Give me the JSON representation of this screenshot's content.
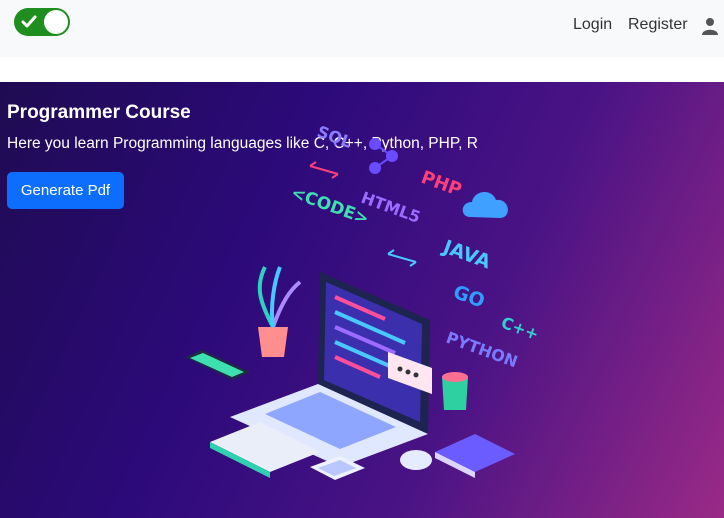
{
  "navbar": {
    "toggle_state": "on",
    "login_label": "Login",
    "register_label": "Register",
    "user_icon": "user-icon"
  },
  "hero": {
    "title": "Programmer Course",
    "subtitle": "Here you learn Programming languages like C, C++, Python, PHP, R",
    "button_label": "Generate Pdf",
    "illustration": {
      "tags": {
        "sql": "SQL",
        "code": "<CODE>",
        "html": "HTML5",
        "php": "PHP",
        "java": "JAVA",
        "go": "GO",
        "python": "PYTHON",
        "cpp": "C++"
      }
    }
  },
  "colors": {
    "navbar_bg": "#f8f9fa",
    "toggle_on": "#1e8e1e",
    "primary_button": "#0d6efd",
    "hero_gradient_start": "#1f0b52",
    "hero_gradient_end": "#9a2a86"
  }
}
